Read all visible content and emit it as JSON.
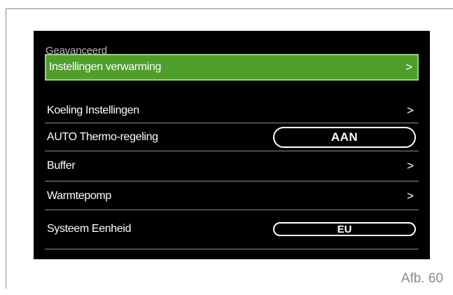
{
  "screen": {
    "header": "Geavanceerd",
    "items": [
      {
        "label": "Instellingen verwarming",
        "action": ">",
        "selected": true
      },
      {
        "label": "Koeling Instellingen",
        "action": ">"
      },
      {
        "label": "AUTO Thermo-regeling",
        "value": "AAN"
      },
      {
        "label": "Buffer",
        "action": ">"
      },
      {
        "label": "Warmtepomp",
        "action": ">"
      },
      {
        "label": "Systeem Eenheid",
        "value": "EU"
      }
    ]
  },
  "caption": "Afb. 60",
  "colors": {
    "background": "#000000",
    "selected": "#4f9e2b",
    "selected_border": "#9bd07a",
    "text": "#ffffff",
    "header_text": "#b9b9b9"
  }
}
